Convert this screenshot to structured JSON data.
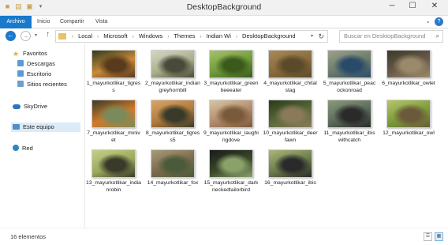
{
  "window": {
    "title": "DesktopBackground"
  },
  "ribbon": {
    "tabs": [
      "Archivo",
      "Inicio",
      "Compartir",
      "Vista"
    ]
  },
  "address": {
    "crumbs": [
      "Local",
      "Microsoft",
      "Windows",
      "Themes",
      "Indian Wi",
      "DesktopBackground"
    ]
  },
  "search": {
    "placeholder": "Buscar en DesktopBackground"
  },
  "sidebar": {
    "favorites": "Favoritos",
    "descargas": "Descargas",
    "escritorio": "Escritorio",
    "recientes": "Sitios recientes",
    "skydrive": "SkyDrive",
    "equipo": "Este equipo",
    "red": "Red"
  },
  "files": [
    {
      "name": "1_mayurkotlikar_tigress",
      "palette": [
        "#c98a3a",
        "#5a3a1c",
        "#2f3a1e"
      ]
    },
    {
      "name": "2_mayurkotlikar_indiangreyhornbill",
      "palette": [
        "#aab08a",
        "#4a4a3a",
        "#d6d6c6"
      ]
    },
    {
      "name": "3_mayurkotlikar_greenbeeeater",
      "palette": [
        "#6f9a3a",
        "#3a5a1c",
        "#a6c26a"
      ]
    },
    {
      "name": "4_mayurkotlikar_chitalstag",
      "palette": [
        "#8a6a3a",
        "#5a4a2a",
        "#a68a5a"
      ]
    },
    {
      "name": "5_mayurkotlikar_peacockonroad",
      "palette": [
        "#6a7a6a",
        "#2a4a6a",
        "#9aa28a"
      ]
    },
    {
      "name": "6_mayurkotlikar_owlet",
      "palette": [
        "#6a5a4a",
        "#9a8a6a",
        "#3a3a2a"
      ]
    },
    {
      "name": "7_mayurkotlikar_minivet",
      "palette": [
        "#d07a2a",
        "#7a8a5a",
        "#3a3a2a"
      ]
    },
    {
      "name": "8_mayurkotlikar_tigress5",
      "palette": [
        "#b07a3a",
        "#3a3a2a",
        "#d6a66a"
      ]
    },
    {
      "name": "9_mayurkotlikar_laughingdove",
      "palette": [
        "#b08a6a",
        "#7a5a3a",
        "#d6c6a6"
      ]
    },
    {
      "name": "10_mayurkotlikar_deerfawn",
      "palette": [
        "#5a6a3a",
        "#8a7a5a",
        "#2a3a1a"
      ]
    },
    {
      "name": "11_mayurkotlikar_ibiswithcatch",
      "palette": [
        "#5a6a5a",
        "#2a2a2a",
        "#8a9a7a"
      ]
    },
    {
      "name": "12_mayurkotlikar_owl",
      "palette": [
        "#7a9a3a",
        "#6a5a3a",
        "#b6c66a"
      ]
    },
    {
      "name": "13_mayurkotlikar_indianrobin",
      "palette": [
        "#9aaa5a",
        "#3a3a2a",
        "#c6ce8a"
      ]
    },
    {
      "name": "14_mayurkotlikar_fox",
      "palette": [
        "#7a6a4a",
        "#4a5a3a",
        "#a69a7a"
      ]
    },
    {
      "name": "15_mayurkotlikar_darkneckedtailorbird",
      "palette": [
        "#3a4a2a",
        "#8aa26a",
        "#1a1a1a"
      ]
    },
    {
      "name": "16_mayurkotlikar_ibis",
      "palette": [
        "#6a7a4a",
        "#2a2a2a",
        "#aab67a"
      ]
    }
  ],
  "status": {
    "count": "16 elementos"
  }
}
